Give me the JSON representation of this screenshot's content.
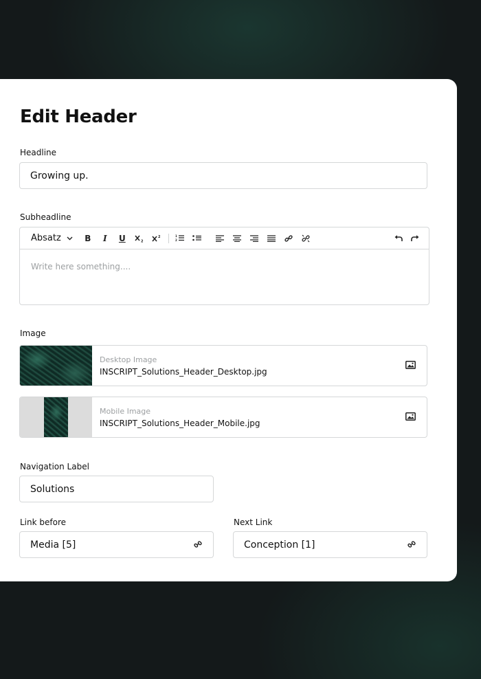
{
  "title": "Edit Header",
  "headline": {
    "label": "Headline",
    "value": "Growing up."
  },
  "subheadline": {
    "label": "Subheadline",
    "format_select": "Absatz",
    "placeholder": "Write here something...."
  },
  "image": {
    "label": "Image",
    "desktop": {
      "title": "Desktop Image",
      "file": "INSCRIPT_Solutions_Header_Desktop.jpg"
    },
    "mobile": {
      "title": "Mobile Image",
      "file": "INSCRIPT_Solutions_Header_Mobile.jpg"
    }
  },
  "navigation": {
    "label": "Navigation Label",
    "value": "Solutions"
  },
  "link_before": {
    "label": "Link before",
    "value": "Media [5]"
  },
  "next_link": {
    "label": "Next Link",
    "value": "Conception [1]"
  },
  "colors": {
    "background": "#14191a",
    "card": "#ffffff",
    "border": "#d5d7d8",
    "placeholder": "#9c9fa1"
  }
}
